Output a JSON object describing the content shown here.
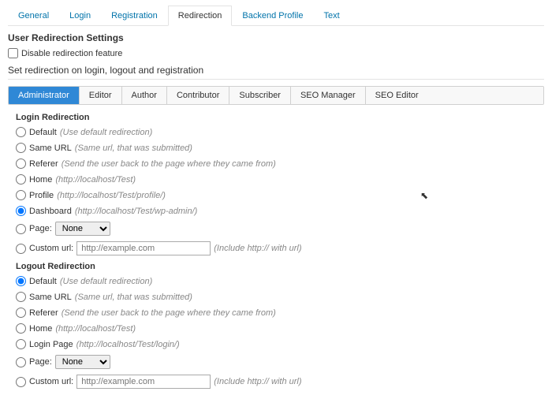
{
  "nav": {
    "tabs": [
      {
        "label": "General",
        "active": false
      },
      {
        "label": "Login",
        "active": false
      },
      {
        "label": "Registration",
        "active": false
      },
      {
        "label": "Redirection",
        "active": true
      },
      {
        "label": "Backend Profile",
        "active": false
      },
      {
        "label": "Text",
        "active": false
      }
    ]
  },
  "section_title": "User Redirection Settings",
  "disable_label": "Disable redirection feature",
  "disable_checked": false,
  "sub_title": "Set redirection on login, logout and registration",
  "roles": [
    {
      "label": "Administrator",
      "active": true
    },
    {
      "label": "Editor",
      "active": false
    },
    {
      "label": "Author",
      "active": false
    },
    {
      "label": "Contributor",
      "active": false
    },
    {
      "label": "Subscriber",
      "active": false
    },
    {
      "label": "SEO Manager",
      "active": false
    },
    {
      "label": "SEO Editor",
      "active": false
    }
  ],
  "login": {
    "title": "Login Redirection",
    "options": [
      {
        "label": "Default",
        "hint": "(Use default redirection)",
        "checked": false
      },
      {
        "label": "Same URL",
        "hint": "(Same url, that was submitted)",
        "checked": false
      },
      {
        "label": "Referer",
        "hint": "(Send the user back to the page where they came from)",
        "checked": false
      },
      {
        "label": "Home",
        "hint": "(http://localhost/Test)",
        "checked": false
      },
      {
        "label": "Profile",
        "hint": "(http://localhost/Test/profile/)",
        "checked": false
      },
      {
        "label": "Dashboard",
        "hint": "(http://localhost/Test/wp-admin/)",
        "checked": true
      }
    ],
    "page_label": "Page:",
    "page_value": "None",
    "custom_label": "Custom url:",
    "custom_placeholder": "http://example.com",
    "custom_hint": "(Include http:// with url)"
  },
  "logout": {
    "title": "Logout Redirection",
    "options": [
      {
        "label": "Default",
        "hint": "(Use default redirection)",
        "checked": true
      },
      {
        "label": "Same URL",
        "hint": "(Same url, that was submitted)",
        "checked": false
      },
      {
        "label": "Referer",
        "hint": "(Send the user back to the page where they came from)",
        "checked": false
      },
      {
        "label": "Home",
        "hint": "(http://localhost/Test)",
        "checked": false
      },
      {
        "label": "Login Page",
        "hint": "(http://localhost/Test/login/)",
        "checked": false
      }
    ],
    "page_label": "Page:",
    "page_value": "None",
    "custom_label": "Custom url:",
    "custom_placeholder": "http://example.com",
    "custom_hint": "(Include http:// with url)"
  }
}
